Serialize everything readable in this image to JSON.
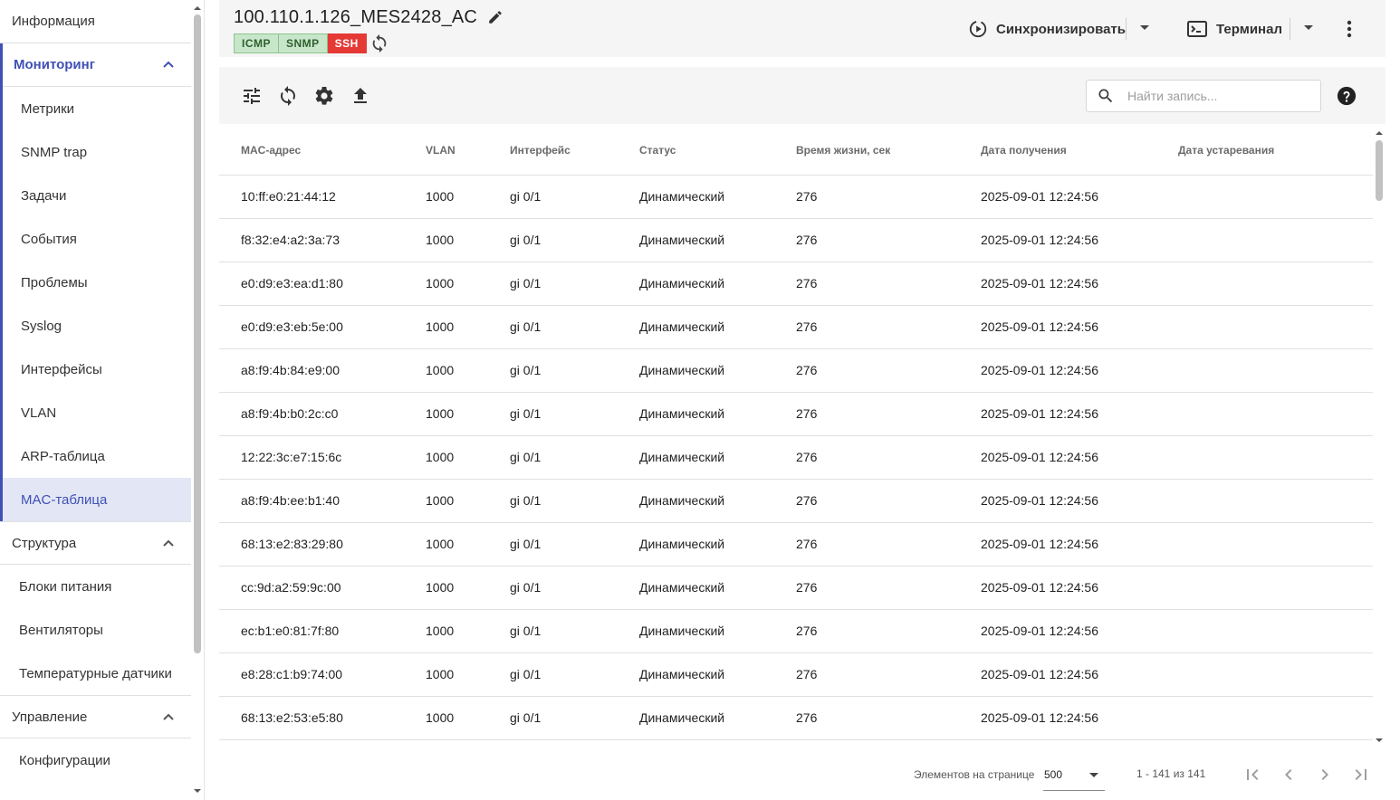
{
  "sidebar": {
    "info": "Информация",
    "monitoring": {
      "label": "Мониторинг",
      "items": [
        "Метрики",
        "SNMP trap",
        "Задачи",
        "События",
        "Проблемы",
        "Syslog",
        "Интерфейсы",
        "VLAN",
        "ARP-таблица",
        "MAC-таблица"
      ],
      "active": "MAC-таблица"
    },
    "structure": {
      "label": "Структура",
      "items": [
        "Блоки питания",
        "Вентиляторы",
        "Температурные датчики"
      ]
    },
    "management": {
      "label": "Управление",
      "items": [
        "Конфигурации"
      ]
    }
  },
  "header": {
    "device_name": "100.110.1.126_MES2428_AC",
    "badges": [
      {
        "label": "ICMP",
        "state": "ok"
      },
      {
        "label": "SNMP",
        "state": "ok"
      },
      {
        "label": "SSH",
        "state": "error"
      }
    ],
    "sync_label": "Синхронизировать",
    "terminal_label": "Терминал"
  },
  "toolbar": {
    "search_placeholder": "Найти запись..."
  },
  "table": {
    "columns": [
      "MAC-адрес",
      "VLAN",
      "Интерфейс",
      "Статус",
      "Время жизни, сек",
      "Дата получения",
      "Дата устаревания"
    ],
    "rows": [
      [
        "10:ff:e0:21:44:12",
        "1000",
        "gi 0/1",
        "Динамический",
        "276",
        "2025-09-01 12:24:56",
        ""
      ],
      [
        "f8:32:e4:a2:3a:73",
        "1000",
        "gi 0/1",
        "Динамический",
        "276",
        "2025-09-01 12:24:56",
        ""
      ],
      [
        "e0:d9:e3:ea:d1:80",
        "1000",
        "gi 0/1",
        "Динамический",
        "276",
        "2025-09-01 12:24:56",
        ""
      ],
      [
        "e0:d9:e3:eb:5e:00",
        "1000",
        "gi 0/1",
        "Динамический",
        "276",
        "2025-09-01 12:24:56",
        ""
      ],
      [
        "a8:f9:4b:84:e9:00",
        "1000",
        "gi 0/1",
        "Динамический",
        "276",
        "2025-09-01 12:24:56",
        ""
      ],
      [
        "a8:f9:4b:b0:2c:c0",
        "1000",
        "gi 0/1",
        "Динамический",
        "276",
        "2025-09-01 12:24:56",
        ""
      ],
      [
        "12:22:3c:e7:15:6c",
        "1000",
        "gi 0/1",
        "Динамический",
        "276",
        "2025-09-01 12:24:56",
        ""
      ],
      [
        "a8:f9:4b:ee:b1:40",
        "1000",
        "gi 0/1",
        "Динамический",
        "276",
        "2025-09-01 12:24:56",
        ""
      ],
      [
        "68:13:e2:83:29:80",
        "1000",
        "gi 0/1",
        "Динамический",
        "276",
        "2025-09-01 12:24:56",
        ""
      ],
      [
        "cc:9d:a2:59:9c:00",
        "1000",
        "gi 0/1",
        "Динамический",
        "276",
        "2025-09-01 12:24:56",
        ""
      ],
      [
        "ec:b1:e0:81:7f:80",
        "1000",
        "gi 0/1",
        "Динамический",
        "276",
        "2025-09-01 12:24:56",
        ""
      ],
      [
        "e8:28:c1:b9:74:00",
        "1000",
        "gi 0/1",
        "Динамический",
        "276",
        "2025-09-01 12:24:56",
        ""
      ],
      [
        "68:13:e2:53:e5:80",
        "1000",
        "gi 0/1",
        "Динамический",
        "276",
        "2025-09-01 12:24:56",
        ""
      ]
    ]
  },
  "paginator": {
    "items_per_page_label": "Элементов на странице",
    "page_size": "500",
    "range_label": "1 - 141 из 141"
  },
  "colors": {
    "accent": "#3f51b5",
    "active_bg": "#e3e6f5",
    "badge_ok_bg": "#c8e6c9",
    "badge_error_bg": "#e53935",
    "panel_bg": "#f5f5f5"
  }
}
